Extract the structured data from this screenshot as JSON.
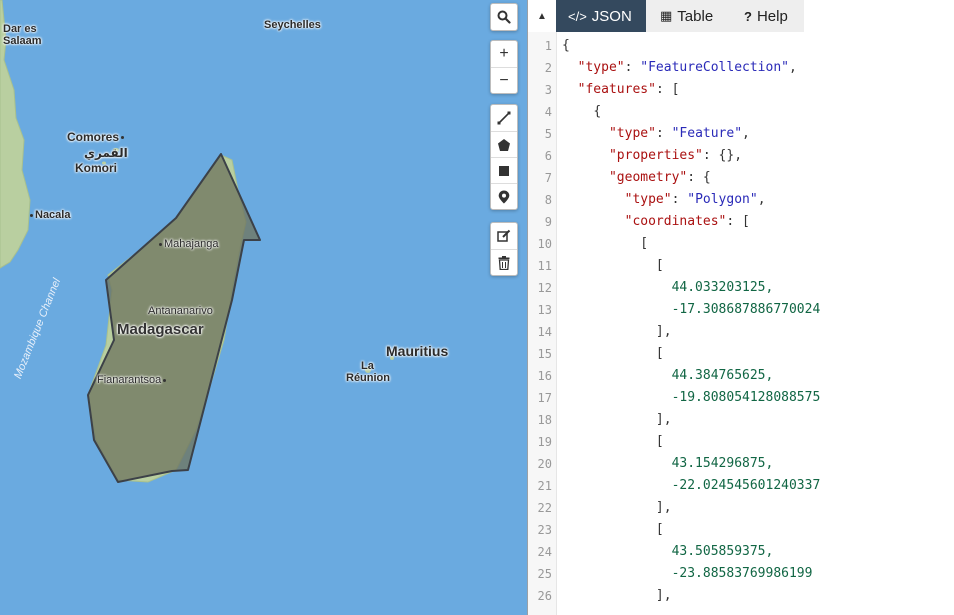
{
  "map": {
    "labels": {
      "dar": "Dar es\nSalaam",
      "seychelles": "Seychelles",
      "comores": "Comores",
      "comores_ar": "القمري",
      "komori": "Komori",
      "nacala": "Nacala",
      "mahajanga": "Mahajanga",
      "antananarivo": "Antananarivo",
      "madagascar": "Madagascar",
      "fianarantsoa": "Fianarantsoa",
      "mozambique_channel": "Mozambique Channel",
      "mauritius": "Mauritius",
      "la": "La",
      "reunion": "Réunion"
    },
    "controls": {
      "search": "search-icon",
      "zoom_in": "+",
      "zoom_out": "−",
      "draw_line": "line-icon",
      "draw_polygon": "polygon-icon",
      "draw_rectangle": "rectangle-icon",
      "draw_marker": "marker-icon",
      "edit": "edit-icon",
      "delete": "trash-icon"
    },
    "colors": {
      "water": "#6aaae0",
      "land": "#b9cfa0",
      "polygon_fill": "#6f7660",
      "polygon_stroke": "#3c4148"
    }
  },
  "panel": {
    "tabs": [
      {
        "icon": "</>",
        "label": "JSON",
        "active": true
      },
      {
        "icon": "▦",
        "label": "Table",
        "active": false
      },
      {
        "icon": "?",
        "label": "Help",
        "active": false
      }
    ],
    "collapse_icon": "▲",
    "line_numbers": [
      "1",
      "2",
      "3",
      "4",
      "5",
      "6",
      "7",
      "8",
      "9",
      "10",
      "11",
      "12",
      "13",
      "14",
      "15",
      "16",
      "17",
      "18",
      "19",
      "20",
      "21",
      "22",
      "23",
      "24",
      "25",
      "26"
    ],
    "code": {
      "l1": "{",
      "l2_key": "\"type\"",
      "l2_val": "\"FeatureCollection\"",
      "l3_key": "\"features\"",
      "l3_rest": ": [",
      "l4": "{",
      "l5_key": "\"type\"",
      "l5_val": "\"Feature\"",
      "l6_key": "\"properties\"",
      "l6_rest": ": {},",
      "l7_key": "\"geometry\"",
      "l7_rest": ": {",
      "l8_key": "\"type\"",
      "l8_val": "\"Polygon\"",
      "l9_key": "\"coordinates\"",
      "l9_rest": ": [",
      "l10": "[",
      "l11": "[",
      "l12": "44.033203125,",
      "l13": "-17.308687886770024",
      "l14": "],",
      "l15": "[",
      "l16": "44.384765625,",
      "l17": "-19.808054128088575",
      "l18": "],",
      "l19": "[",
      "l20": "43.154296875,",
      "l21": "-22.024545601240337",
      "l22": "],",
      "l23": "[",
      "l24": "43.505859375,",
      "l25": "-23.88583769986199",
      "l26": "],"
    }
  }
}
